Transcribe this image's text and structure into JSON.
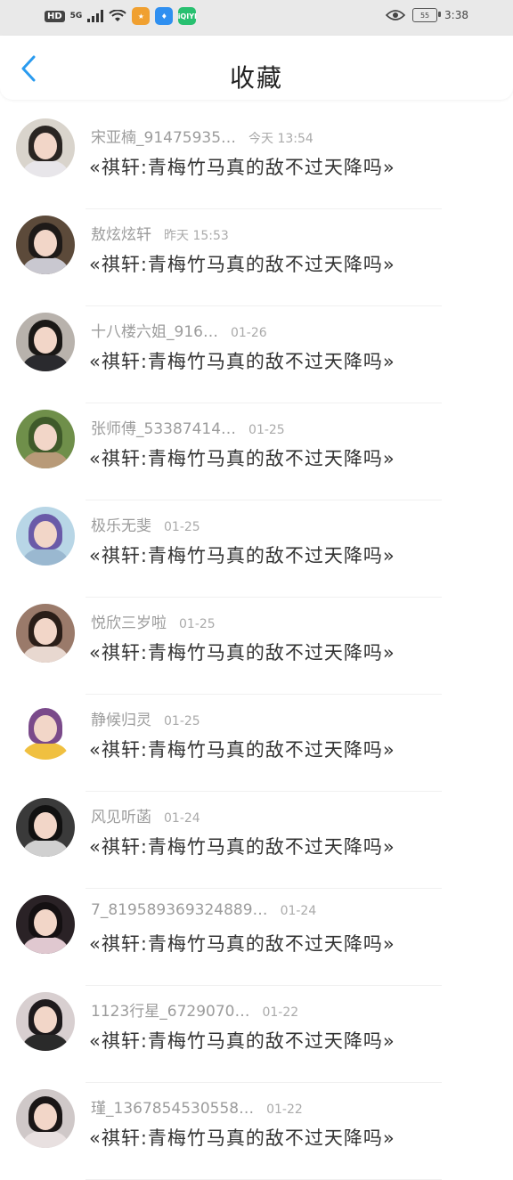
{
  "status_bar": {
    "hd": "HD",
    "network": "5G",
    "battery": "55",
    "time": "3:38",
    "app_icons": [
      {
        "name": "game-app-icon",
        "color": "#f0a030"
      },
      {
        "name": "bulb-app-icon",
        "color": "#2f8ff0"
      },
      {
        "name": "iqiyi-app-icon",
        "color": "#28c070",
        "label": "iQIYI"
      }
    ]
  },
  "header": {
    "title": "收藏"
  },
  "list": {
    "items": [
      {
        "name": "宋亚楠_91475935…",
        "time": "今天 13:54",
        "title": "«祺轩:青梅竹马真的敌不过天降吗»",
        "avatar": {
          "bg": "#d9d4cc",
          "hair": "#2a2522",
          "body": "#e8e6ea"
        }
      },
      {
        "name": "敖炫炫轩",
        "time": "昨天 15:53",
        "title": "«祺轩:青梅竹马真的敌不过天降吗»",
        "avatar": {
          "bg": "#5c4a3a",
          "hair": "#1e1a18",
          "body": "#c9c8d0"
        }
      },
      {
        "name": "十八楼六姐_916…",
        "time": "01-26",
        "title": "«祺轩:青梅竹马真的敌不过天降吗»",
        "avatar": {
          "bg": "#b8b2ac",
          "hair": "#1a1816",
          "body": "#2a2a2e"
        }
      },
      {
        "name": "张师傅_53387414…",
        "time": "01-25",
        "title": "«祺轩:青梅竹马真的敌不过天降吗»",
        "avatar": {
          "bg": "#6f8f4a",
          "hair": "#3f5a2a",
          "body": "#b89a78"
        }
      },
      {
        "name": "极乐无斐",
        "time": "01-25",
        "title": "«祺轩:青梅竹马真的敌不过天降吗»",
        "avatar": {
          "bg": "#b8d6e6",
          "hair": "#6a5aa8",
          "body": "#9ab8d0"
        }
      },
      {
        "name": "悦欣三岁啦",
        "time": "01-25",
        "title": "«祺轩:青梅竹马真的敌不过天降吗»",
        "avatar": {
          "bg": "#9a7a6a",
          "hair": "#2a1e18",
          "body": "#e8d8d0"
        }
      },
      {
        "name": "静候归灵",
        "time": "01-25",
        "title": "«祺轩:青梅竹马真的敌不过天降吗»",
        "avatar": {
          "bg": "#ffffff",
          "hair": "#7a4a8a",
          "body": "#f0c040"
        }
      },
      {
        "name": "风见听菡",
        "time": "01-24",
        "title": "«祺轩:青梅竹马真的敌不过天降吗»",
        "avatar": {
          "bg": "#3a3a3a",
          "hair": "#111111",
          "body": "#d0d0d0"
        }
      },
      {
        "name": "7_819589369324889…",
        "time": "01-24",
        "title": "«祺轩:青梅竹马真的敌不过天降吗»",
        "avatar": {
          "bg": "#2a2226",
          "hair": "#141012",
          "body": "#e0c8d0"
        }
      },
      {
        "name": "1123行星_6729070…",
        "time": "01-22",
        "title": "«祺轩:青梅竹马真的敌不过天降吗»",
        "avatar": {
          "bg": "#d8cfd0",
          "hair": "#1e1a1c",
          "body": "#2a2a2a"
        }
      },
      {
        "name": "瑾_1367854530558…",
        "time": "01-22",
        "title": "«祺轩:青梅竹马真的敌不过天降吗»",
        "avatar": {
          "bg": "#cfc8c8",
          "hair": "#1a1616",
          "body": "#e8e0e0"
        }
      }
    ]
  },
  "colors": {
    "accent": "#2a9bef",
    "status_bar_bg": "#e9e9e9"
  }
}
